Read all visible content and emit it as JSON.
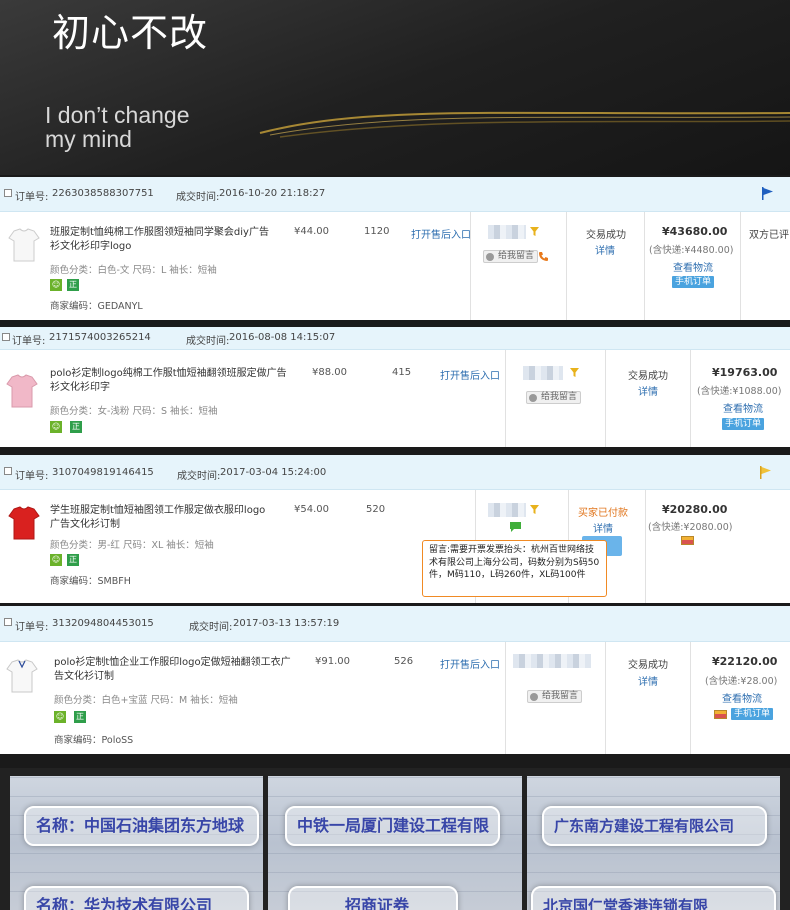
{
  "banner": {
    "title": "初心不改",
    "subtitle_line1": "I don’t change",
    "subtitle_line2": "my mind"
  },
  "orders": [
    {
      "order_label": "订单号:",
      "order_no": "2263038588307751",
      "time_label": "成交时间:",
      "time": "2016-10-20 21:18:27",
      "product": "班服定制t恤纯棉工作服图领短袖同学聚会diy广告衫文化衫印字logo",
      "attrs": "颜色分类：白色-文   尺码：L   袖长：短袖",
      "merchant_code": "商家编码：GEDANYL",
      "price": "¥44.00",
      "qty": "1120",
      "after_sale": "打开售后入口",
      "message_btn": "给我留言",
      "status": "交易成功",
      "detail": "详情",
      "total": "¥43680.00",
      "shipping": "(含快递:¥4480.00)",
      "logistics": "查看物流",
      "mobile": "手机订单",
      "extra": "双方已评"
    },
    {
      "order_label": "订单号:",
      "order_no": "2171574003265214",
      "time_label": "成交时间:",
      "time": "2016-08-08 14:15:07",
      "product": "polo衫定制logo纯棉工作服t恤短袖翻领班服定做广告衫文化衫印字",
      "attrs": "颜色分类：女-浅粉   尺码：S   袖长：短袖",
      "price": "¥88.00",
      "qty": "415",
      "after_sale": "打开售后入口",
      "message_btn": "给我留言",
      "status": "交易成功",
      "detail": "详情",
      "total": "¥19763.00",
      "shipping": "(含快递:¥1088.00)",
      "logistics": "查看物流",
      "mobile": "手机订单"
    },
    {
      "order_label": "订单号:",
      "order_no": "3107049819146415",
      "time_label": "成交时间:",
      "time": "2017-03-04 15:24:00",
      "product": "学生班服定制t恤短袖图领工作服定做衣服印logo广告文化衫订制",
      "attrs": "颜色分类：男-红   尺码：XL   袖长：短袖",
      "merchant_code": "商家编码：SMBFH",
      "price": "¥54.00",
      "qty": "520",
      "status": "买家已付款",
      "detail": "详情",
      "total": "¥20280.00",
      "shipping": "(含快递:¥2080.00)",
      "tooltip": "留言:需要开票发票抬头：杭州百世网络技术有限公司上海分公司，码数分别为S码50件，M码110，L码260件，XL码100件"
    },
    {
      "order_label": "订单号:",
      "order_no": "3132094804453015",
      "time_label": "成交时间:",
      "time": "2017-03-13 13:57:19",
      "product": "polo衫定制t恤企业工作服印logo定做短袖翻领工衣广告文化衫订制",
      "attrs": "颜色分类：白色+宝蓝   尺码：M   袖长：短袖",
      "merchant_code": "商家编码：PoloSS",
      "price": "¥91.00",
      "qty": "526",
      "after_sale": "打开售后入口",
      "message_btn": "给我留言",
      "status": "交易成功",
      "detail": "详情",
      "total": "¥22120.00",
      "shipping": "(含快递:¥28.00)",
      "logistics": "查看物流",
      "mobile": "手机订单"
    }
  ],
  "badges": {
    "b1": "☺",
    "b2": "正"
  },
  "photos": {
    "p1_a": "名称：中国石油集团东方地球",
    "p1_b": "名称：华为技术有限公司",
    "p2_a": "中铁一局厦门建设工程有限",
    "p2_b": "招商证券",
    "p3_a": "广东南方建设工程有限公司",
    "p3_b": "北京国仁堂香港连锁有限"
  },
  "colors": {
    "accent_blue": "#2f6fb0",
    "header_bg": "#e6f4fb",
    "tooltip_border": "#f08a24"
  }
}
